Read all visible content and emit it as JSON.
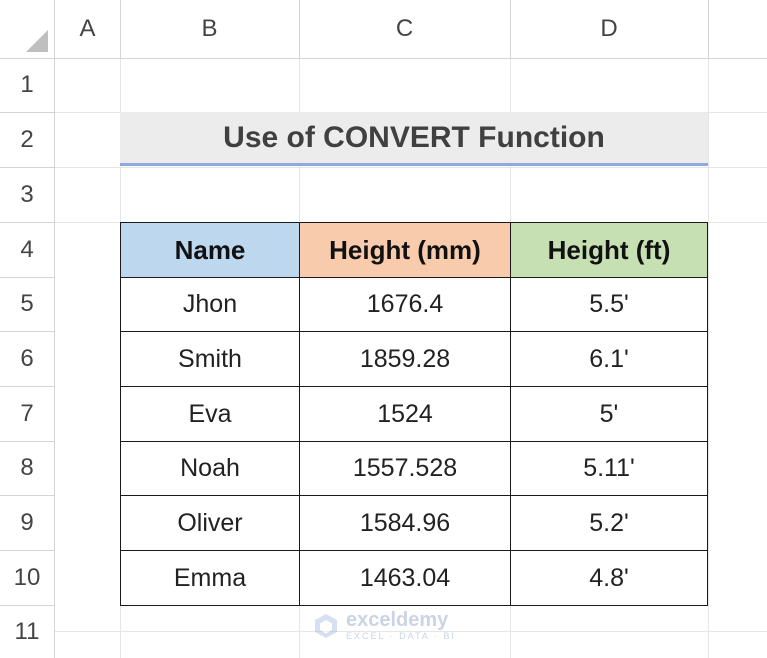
{
  "columns": [
    "A",
    "B",
    "C",
    "D"
  ],
  "rows": [
    "1",
    "2",
    "3",
    "4",
    "5",
    "6",
    "7",
    "8",
    "9",
    "10",
    "11"
  ],
  "title": "Use of CONVERT Function",
  "table": {
    "headers": [
      "Name",
      "Height (mm)",
      "Height (ft)"
    ],
    "header_colors": [
      "#bdd7ee",
      "#f8cbad",
      "#c6e0b4"
    ],
    "rows": [
      [
        "Jhon",
        "1676.4",
        "5.5'"
      ],
      [
        "Smith",
        "1859.28",
        "6.1'"
      ],
      [
        "Eva",
        "1524",
        "5'"
      ],
      [
        "Noah",
        "1557.528",
        "5.11'"
      ],
      [
        "Oliver",
        "1584.96",
        "5.2'"
      ],
      [
        "Emma",
        "1463.04",
        "4.8'"
      ]
    ]
  },
  "watermark": {
    "name": "exceldemy",
    "tagline": "EXCEL · DATA · BI",
    "icon": "exceldemy-logo-icon"
  }
}
